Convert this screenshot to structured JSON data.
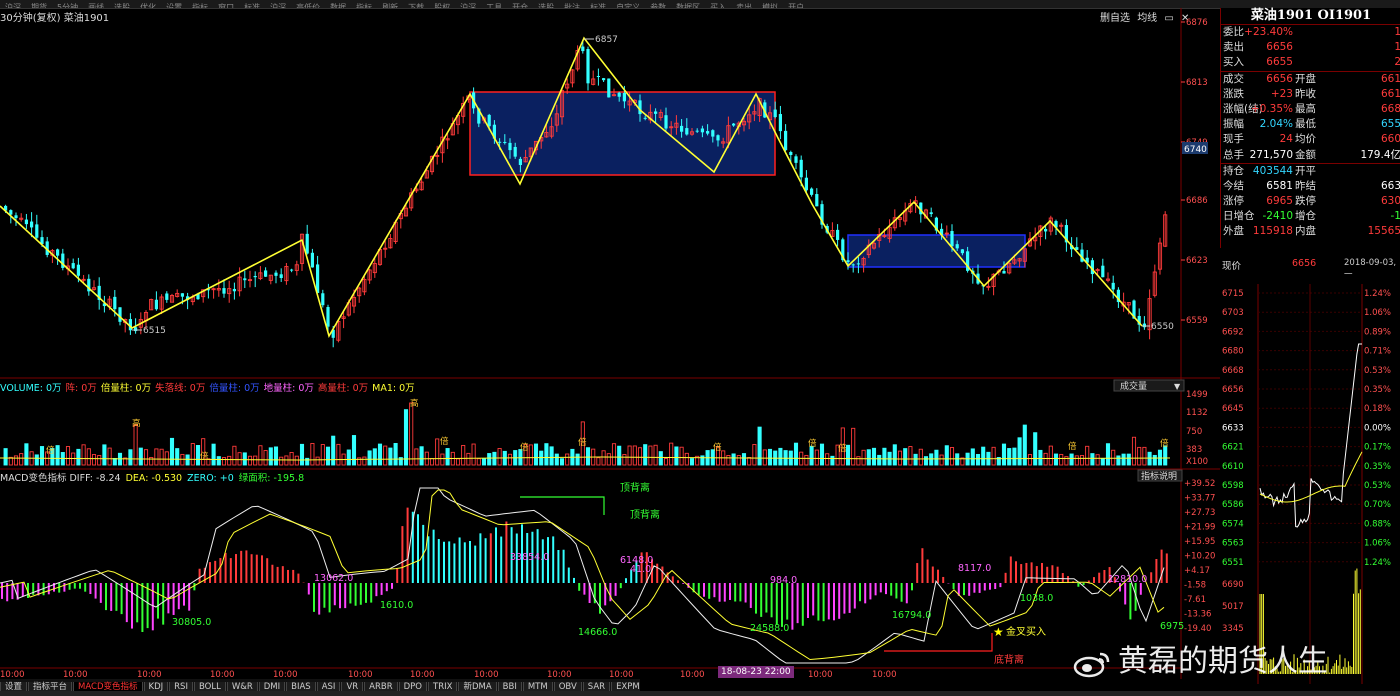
{
  "topbar": {
    "items": [
      "沪深",
      "期货",
      "5分钟",
      "画线",
      "选股",
      "优化",
      "设置",
      "指标",
      "窗口",
      "标准",
      "沪深",
      "高低价",
      "数据",
      "指标",
      "刷新",
      "下载",
      "股权",
      "沪深",
      "工具",
      "开仓",
      "选股",
      "批注",
      "标准",
      "自定义",
      "参数",
      "数据区",
      "买入",
      "卖出",
      "模拟",
      "开户"
    ]
  },
  "chart": {
    "title": "30分钟(复权) 菜油1901",
    "controls": [
      "删自选",
      "均线"
    ],
    "price_axis": [
      "6876",
      "6813",
      "6749",
      "6686",
      "6623",
      "6559"
    ],
    "current_price_tag": "6740",
    "annotations": {
      "high": "6857",
      "low1": "6515",
      "low2": "6550"
    }
  },
  "volume": {
    "legend": [
      "VOLUME: 0万",
      "阵: 0万",
      "倍量柱: 0万",
      "失落线: 0万",
      "倍量柱: 0万",
      "地量柱: 0万",
      "高量柱: 0万",
      "MA1: 0万"
    ],
    "dropdown": "成交量",
    "axis": [
      "1499",
      "1132",
      "750",
      "383",
      "X100"
    ],
    "labels": {
      "gao": "高",
      "bei": "倍"
    }
  },
  "macd": {
    "legend": [
      "MACD变色指标 DIFF: -8.24",
      "DEA: -0.530",
      "ZERO: +0",
      "绿面积: -195.8"
    ],
    "help": "指标说明",
    "axis": [
      "+39.52",
      "+33.77",
      "+27.73",
      "+21.99",
      "+15.95",
      "+10.20",
      "+4.17",
      "-1.58",
      "-7.61",
      "-13.36",
      "-19.40"
    ],
    "labels": [
      "顶背离",
      "顶背离",
      "33854.0",
      "6148.0",
      "41.0",
      "13062.0",
      "984.0",
      "8117.0",
      "12810.0",
      "1610.0",
      "1038.0",
      "16794.0",
      "30805.0",
      "14666.0",
      "24588.0",
      "6975",
      "金叉买入",
      "底背离"
    ],
    "date_box": "18-08-23 22:00"
  },
  "time_labels": [
    "10:00",
    "10:00",
    "10:00",
    "10:00",
    "10:00",
    "10:00",
    "10:00",
    "10:00",
    "10:00",
    "10:00",
    "10:00",
    "10:00",
    "10:00",
    "10:00"
  ],
  "quote": {
    "title": "菜油1901 OI1901",
    "rows": [
      {
        "l": "委比",
        "v": "+23.40%",
        "l2": "",
        "v2": "1",
        "c": "#ff3b3b"
      },
      {
        "l": "卖出",
        "v": "6656",
        "l2": "",
        "v2": "1",
        "c": "#ff3b3b"
      },
      {
        "l": "买入",
        "v": "6655",
        "l2": "",
        "v2": "2",
        "c": "#ff3b3b"
      },
      {
        "l": "成交",
        "v": "6656",
        "l2": "开盘",
        "v2": "661",
        "c": "#ff3b3b"
      },
      {
        "l": "涨跌",
        "v": "+23",
        "l2": "昨收",
        "v2": "661",
        "c": "#ff3b3b"
      },
      {
        "l": "涨幅(结)",
        "v": "+0.35%",
        "l2": "最高",
        "v2": "668",
        "c": "#ff3b3b"
      },
      {
        "l": "振幅",
        "v": "2.04%",
        "l2": "最低",
        "v2": "655",
        "c": "#33d6ff"
      },
      {
        "l": "现手",
        "v": "24",
        "l2": "均价",
        "v2": "660",
        "c": "#ff3b3b"
      },
      {
        "l": "总手",
        "v": "271,570",
        "l2": "金额",
        "v2": "179.4亿",
        "c": "#fff"
      },
      {
        "l": "持仓",
        "v": "403544",
        "l2": "开平",
        "v2": "",
        "c": "#33d6ff"
      },
      {
        "l": "今结",
        "v": "6581",
        "l2": "昨结",
        "v2": "663",
        "c": "#fff"
      },
      {
        "l": "涨停",
        "v": "6965",
        "l2": "跌停",
        "v2": "630",
        "c": "#ff3b3b"
      },
      {
        "l": "日增仓",
        "v": "-2410",
        "l2": "增仓",
        "v2": "-1",
        "c": "#33ff33"
      },
      {
        "l": "外盘",
        "v": "115918",
        "l2": "内盘",
        "v2": "15565",
        "c": "#ff3b3b"
      }
    ]
  },
  "mini": {
    "price_label": "现价",
    "price": "6656",
    "date": "2018-09-03,一",
    "left_axis": [
      "6715",
      "6703",
      "6692",
      "6680",
      "6668",
      "6656",
      "6645",
      "6633",
      "6621",
      "6610",
      "6598",
      "6586",
      "6574",
      "6563",
      "6551"
    ],
    "right_axis": [
      "1.24%",
      "1.06%",
      "0.89%",
      "0.71%",
      "0.53%",
      "0.35%",
      "0.18%",
      "0.00%",
      "0.17%",
      "0.35%",
      "0.53%",
      "0.70%",
      "0.88%",
      "1.06%",
      "1.24%"
    ],
    "vol_axis": [
      "6690",
      "5017",
      "3345"
    ]
  },
  "tabs": [
    "设置",
    "指标平台",
    "MACD变色指标",
    "KDJ",
    "RSI",
    "BOLL",
    "W&R",
    "DMI",
    "BIAS",
    "ASI",
    "VR",
    "ARBR",
    "DPO",
    "TRIX",
    "新DMA",
    "BBI",
    "MTM",
    "OBV",
    "SAR",
    "EXPMA"
  ],
  "watermark": "黄磊的期货人生",
  "colors": {
    "up": "#ff3b3b",
    "down": "#33ffff",
    "zigzag": "#ffff33",
    "box_fill": "#0a2060",
    "box_border": "#ff2020",
    "axis_red": "#7a0000"
  }
}
